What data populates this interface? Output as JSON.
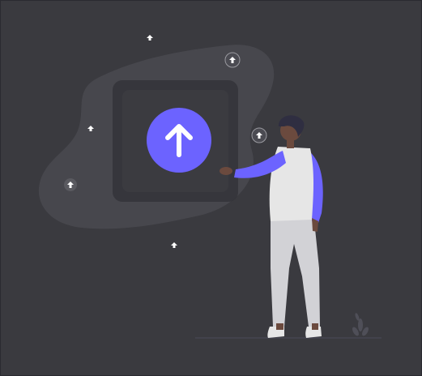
{
  "scene": {
    "background_color": "#3a3a3f",
    "accent_color": "#6c63ff",
    "icons": {
      "main": "upload-arrow-icon",
      "small": "arrow-up-icon",
      "ringed": "arrow-up-circle-icon"
    }
  }
}
